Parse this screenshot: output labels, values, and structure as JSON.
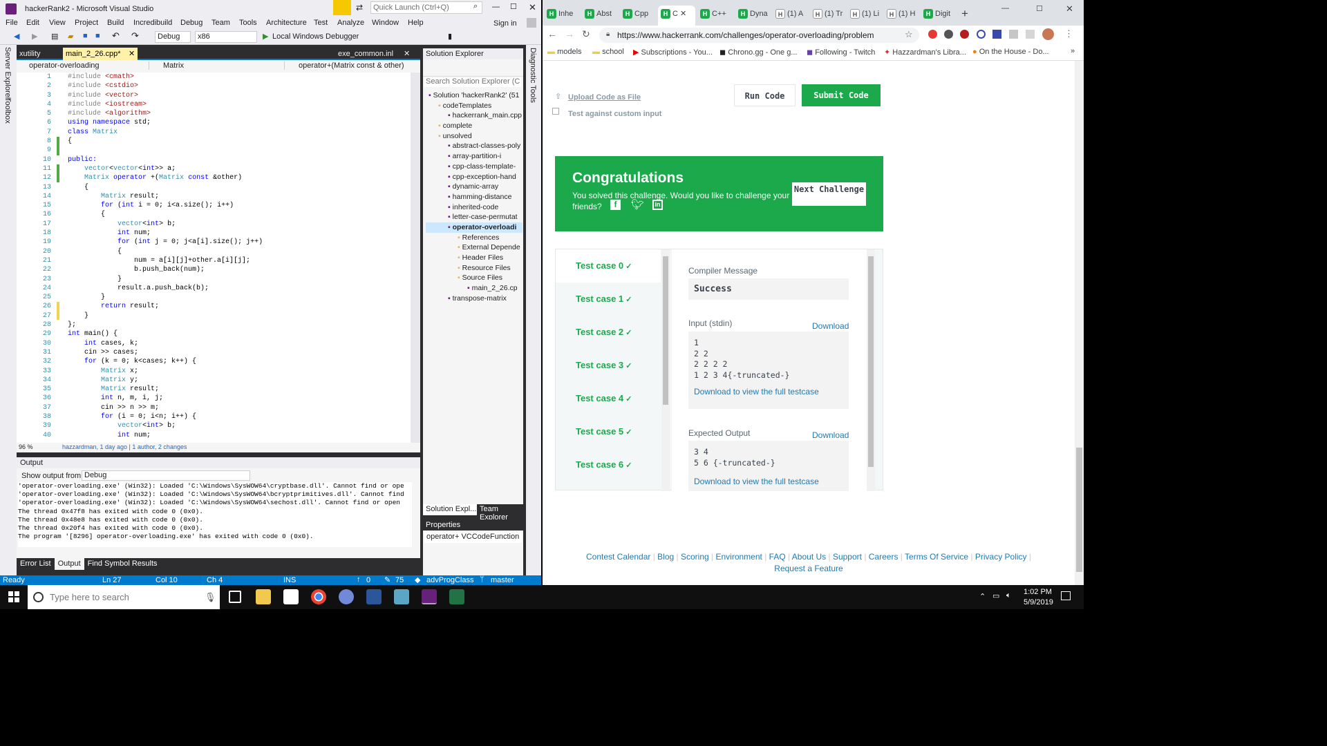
{
  "vs": {
    "title": "hackerRank2 - Microsoft Visual Studio",
    "quick_launch": "Quick Launch (Ctrl+Q)",
    "signin": "Sign in",
    "menu": [
      "File",
      "Edit",
      "View",
      "Project",
      "Build",
      "Incredibuild",
      "Debug",
      "Team",
      "Tools",
      "Architecture",
      "Test",
      "Analyze",
      "Window",
      "Help"
    ],
    "toolbar": {
      "config": "Debug",
      "platform": "x86",
      "debugger": "Local Windows Debugger"
    },
    "side_left": [
      "Server Explorer",
      "Toolbox"
    ],
    "side_right": "Diagnostic Tools",
    "doc_tabs": [
      "xutility",
      "main_2_26.cpp*",
      "exe_common.inl"
    ],
    "nav": {
      "scope": "operator-overloading",
      "class": "Matrix",
      "member": "operator+(Matrix const & other)"
    },
    "code_lines": [
      [
        [
          "#include ",
          "k"
        ],
        [
          "<cmath>",
          "s"
        ]
      ],
      [
        [
          "#include ",
          "k"
        ],
        [
          "<cstdio>",
          "s"
        ]
      ],
      [
        [
          "#include ",
          "k"
        ],
        [
          "<vector>",
          "s"
        ]
      ],
      [
        [
          "#include ",
          "k"
        ],
        [
          "<iostream>",
          "s"
        ]
      ],
      [
        [
          "#include ",
          "k"
        ],
        [
          "<algorithm>",
          "s"
        ]
      ],
      [
        [
          "using namespace ",
          "b"
        ],
        [
          "std;",
          ""
        ]
      ],
      [
        [
          "class ",
          "b"
        ],
        [
          "Matrix",
          "t"
        ]
      ],
      [
        [
          "{",
          ""
        ]
      ],
      [
        [
          "",
          ""
        ]
      ],
      [
        [
          "public:",
          "b"
        ]
      ],
      [
        [
          "    vector",
          "t"
        ],
        [
          "<",
          "",
          ""
        ],
        [
          "vector",
          "t"
        ],
        [
          "<",
          ""
        ],
        [
          "int",
          "b"
        ],
        [
          ">> a;",
          ""
        ]
      ],
      [
        [
          "    Matrix ",
          "t"
        ],
        [
          "operator ",
          "b"
        ],
        [
          "+(",
          ""
        ],
        [
          "Matrix ",
          "t"
        ],
        [
          "const ",
          "b"
        ],
        [
          "&other)",
          ""
        ]
      ],
      [
        [
          "    {",
          ""
        ]
      ],
      [
        [
          "        Matrix ",
          "t"
        ],
        [
          "result;",
          ""
        ]
      ],
      [
        [
          "        for ",
          "b"
        ],
        [
          "(",
          ""
        ],
        [
          "int ",
          "b"
        ],
        [
          "i = 0; i<a.size(); i++)",
          ""
        ]
      ],
      [
        [
          "        {",
          ""
        ]
      ],
      [
        [
          "            vector",
          "t"
        ],
        [
          "<",
          ""
        ],
        [
          "int",
          "b"
        ],
        [
          "> b;",
          ""
        ]
      ],
      [
        [
          "            int ",
          "b"
        ],
        [
          "num;",
          ""
        ]
      ],
      [
        [
          "            for ",
          "b"
        ],
        [
          "(",
          ""
        ],
        [
          "int ",
          "b"
        ],
        [
          "j = 0; j<a[i].size(); j++)",
          ""
        ]
      ],
      [
        [
          "            {",
          ""
        ]
      ],
      [
        [
          "                num = a[i][j]+other.a[i][j];",
          ""
        ]
      ],
      [
        [
          "                b.push_back(num);",
          ""
        ]
      ],
      [
        [
          "            }",
          ""
        ]
      ],
      [
        [
          "            result.a.push_back(b);",
          ""
        ]
      ],
      [
        [
          "        }",
          ""
        ]
      ],
      [
        [
          "        return ",
          "b"
        ],
        [
          "result;",
          ""
        ]
      ],
      [
        [
          "    }",
          ""
        ]
      ],
      [
        [
          "};",
          ""
        ]
      ],
      [
        [
          "int ",
          "b"
        ],
        [
          "main() {",
          ""
        ]
      ],
      [
        [
          "    int ",
          "b"
        ],
        [
          "cases, k;",
          ""
        ]
      ],
      [
        [
          "    cin >> cases;",
          ""
        ]
      ],
      [
        [
          "    for ",
          "b"
        ],
        [
          "(k = 0; k<cases; k++) {",
          ""
        ]
      ],
      [
        [
          "        Matrix ",
          "t"
        ],
        [
          "x;",
          ""
        ]
      ],
      [
        [
          "        Matrix ",
          "t"
        ],
        [
          "y;",
          ""
        ]
      ],
      [
        [
          "        Matrix ",
          "t"
        ],
        [
          "result;",
          ""
        ]
      ],
      [
        [
          "        int ",
          "b"
        ],
        [
          "n, m, i, j;",
          ""
        ]
      ],
      [
        [
          "        cin >> n >> m;",
          ""
        ]
      ],
      [
        [
          "        for ",
          "b"
        ],
        [
          "(i = 0; i<n; i++) {",
          ""
        ]
      ],
      [
        [
          "            vector",
          "t"
        ],
        [
          "<",
          ""
        ],
        [
          "int",
          "b"
        ],
        [
          "> b;",
          ""
        ]
      ],
      [
        [
          "            int ",
          "b"
        ],
        [
          "num;",
          ""
        ]
      ]
    ],
    "zoom": "96 %",
    "codelens": "hazzardman, 1 day ago | 1 author, 2 changes",
    "output": {
      "title": "Output",
      "show_from_label": "Show output from:",
      "show_from": "Debug",
      "lines": [
        "'operator-overloading.exe' (Win32): Loaded 'C:\\Windows\\SysWOW64\\cryptbase.dll'. Cannot find or ope",
        "'operator-overloading.exe' (Win32): Loaded 'C:\\Windows\\SysWOW64\\bcryptprimitives.dll'. Cannot find",
        "'operator-overloading.exe' (Win32): Loaded 'C:\\Windows\\SysWOW64\\sechost.dll'. Cannot find or open",
        "The thread 0x47f8 has exited with code 0 (0x0).",
        "The thread 0x48e8 has exited with code 0 (0x0).",
        "The thread 0x20f4 has exited with code 0 (0x0).",
        "The program '[8296] operator-overloading.exe' has exited with code 0 (0x0)."
      ]
    },
    "bottom_tabs": [
      "Error List",
      "Output",
      "Find Symbol Results"
    ],
    "status": {
      "ready": "Ready",
      "ln": "Ln 27",
      "col": "Col 10",
      "ch": "Ch 4",
      "ins": "INS",
      "up": "0",
      "edits": "75",
      "repo": "advProgClass",
      "branch": "master"
    },
    "solution_explorer": {
      "title": "Solution Explorer",
      "search": "Search Solution Explorer (C",
      "items": [
        {
          "label": "Solution 'hackerRank2' (51",
          "indent": 0
        },
        {
          "label": "codeTemplates",
          "indent": 1
        },
        {
          "label": "hackerrank_main.cpp",
          "indent": 2
        },
        {
          "label": "complete",
          "indent": 1
        },
        {
          "label": "unsolved",
          "indent": 1
        },
        {
          "label": "abstract-classes-poly",
          "indent": 2
        },
        {
          "label": "array-partition-i",
          "indent": 2
        },
        {
          "label": "cpp-class-template-",
          "indent": 2
        },
        {
          "label": "cpp-exception-hand",
          "indent": 2
        },
        {
          "label": "dynamic-array",
          "indent": 2
        },
        {
          "label": "hamming-distance",
          "indent": 2
        },
        {
          "label": "inherited-code",
          "indent": 2
        },
        {
          "label": "letter-case-permutat",
          "indent": 2
        },
        {
          "label": "operator-overloadi",
          "indent": 2
        },
        {
          "label": "References",
          "indent": 3
        },
        {
          "label": "External Depende",
          "indent": 3
        },
        {
          "label": "Header Files",
          "indent": 3
        },
        {
          "label": "Resource Files",
          "indent": 3
        },
        {
          "label": "Source Files",
          "indent": 3
        },
        {
          "label": "main_2_26.cp",
          "indent": 4
        },
        {
          "label": "transpose-matrix",
          "indent": 2
        }
      ],
      "tabs": [
        "Solution Expl...",
        "Team Explorer"
      ]
    },
    "properties": {
      "title": "Properties",
      "selected": "operator+ VCCodeFunction"
    }
  },
  "chrome": {
    "tabs": [
      "Inhe",
      "Abst",
      "Cpp",
      "C",
      "C++",
      "Dyna",
      "(1) A",
      "(1) Tr",
      "(1) Li",
      "(1) H",
      "Digit"
    ],
    "url": "https://www.hackerrank.com/challenges/operator-overloading/problem",
    "bookmarks": [
      "models",
      "school",
      "Subscriptions - You...",
      "Chrono.gg - One g...",
      "Following - Twitch",
      "Hazzardman's Libra...",
      "On the House - Do..."
    ],
    "upload": "Upload Code as File",
    "custom_input": "Test against custom input",
    "run": "Run Code",
    "submit": "Submit Code",
    "congrats_title": "Congratulations",
    "congrats_text": "You solved this challenge. Would you like to challenge your friends?",
    "next": "Next Challenge",
    "test_cases": [
      "Test case 0",
      "Test case 1",
      "Test case 2",
      "Test case 3",
      "Test case 4",
      "Test case 5",
      "Test case 6"
    ],
    "compiler_label": "Compiler Message",
    "compiler_value": "Success",
    "input_label": "Input (stdin)",
    "download": "Download",
    "input_lines": [
      "1",
      "2 2",
      "2 2 2 2",
      "1 2 3 4{-truncated-}"
    ],
    "download_full": "Download to view the full testcase",
    "expected_label": "Expected Output",
    "expected_lines": [
      "3 4",
      "5 6 {-truncated-}"
    ],
    "footer_links": [
      "Contest Calendar",
      "Blog",
      "Scoring",
      "Environment",
      "FAQ",
      "About Us",
      "Support",
      "Careers",
      "Terms Of Service",
      "Privacy Policy",
      "Request a Feature"
    ]
  },
  "taskbar": {
    "search": "Type here to search",
    "time": "1:02 PM",
    "date": "5/9/2019"
  },
  "colors": {
    "vs_blue": "#007acc",
    "hr_green": "#1ba94c",
    "link": "#1f7ab0"
  }
}
